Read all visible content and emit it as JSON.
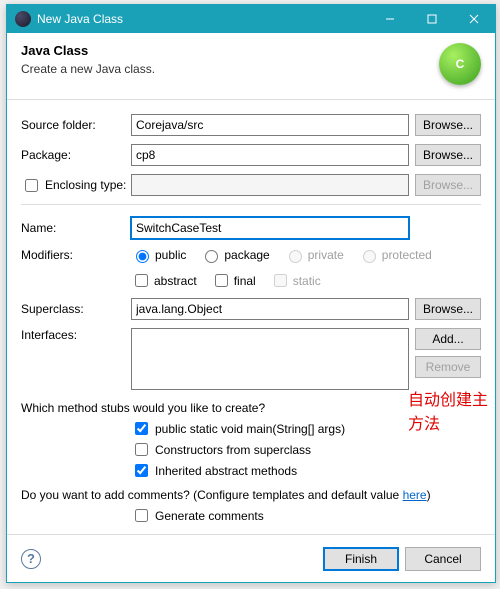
{
  "window": {
    "title": "New Java Class"
  },
  "header": {
    "heading": "Java Class",
    "sub": "Create a new Java class.",
    "icon_letter": "C"
  },
  "labels": {
    "source_folder": "Source folder:",
    "package": "Package:",
    "enclosing_type": "Enclosing type:",
    "name": "Name:",
    "modifiers": "Modifiers:",
    "superclass": "Superclass:",
    "interfaces": "Interfaces:",
    "stubs_q": "Which method stubs would you like to create?",
    "comments_q": "Do you want to add comments? (Configure templates and default value ",
    "here": "here",
    "paren": ")"
  },
  "values": {
    "source_folder": "Corejava/src",
    "package": "cp8",
    "enclosing_type": "",
    "name": "SwitchCaseTest",
    "superclass": "java.lang.Object"
  },
  "buttons": {
    "browse": "Browse...",
    "add": "Add...",
    "remove": "Remove",
    "finish": "Finish",
    "cancel": "Cancel"
  },
  "modifiers": {
    "public": "public",
    "package": "package",
    "private": "private",
    "protected": "protected",
    "abstract": "abstract",
    "final": "final",
    "static": "static"
  },
  "stubs": {
    "main": "public static void main(String[] args)",
    "constructors": "Constructors from superclass",
    "inherited": "Inherited abstract methods"
  },
  "comments": {
    "generate": "Generate comments"
  },
  "annotation": "自动创建主方法"
}
